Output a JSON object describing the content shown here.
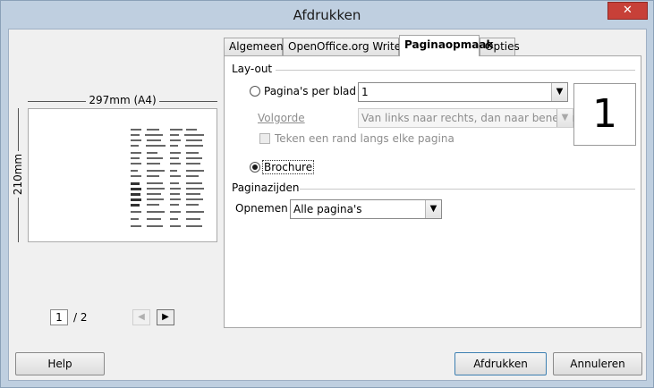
{
  "window": {
    "title": "Afdrukken",
    "close_glyph": "✕"
  },
  "preview": {
    "width_label": "297mm (A4)",
    "height_label": "210mm",
    "page_number": "1",
    "page_total": "/ 2",
    "prev_icon": "◀",
    "next_icon": "▶"
  },
  "tabs": [
    {
      "label": "Algemeen"
    },
    {
      "label": "OpenOffice.org Writer"
    },
    {
      "label": "Paginaopmaak"
    },
    {
      "label": "Opties"
    }
  ],
  "layout": {
    "section_title": "Lay-out",
    "pages_per_sheet_label": "Pagina's per blad",
    "pages_per_sheet_value": "1",
    "order_label": "Volgorde",
    "order_value": "Van links naar rechts, dan naar beneden",
    "border_label": "Teken een rand langs elke pagina",
    "brochure_label": "Brochure",
    "preview_number": "1"
  },
  "page_sides": {
    "section_title": "Paginazijden",
    "include_label": "Opnemen",
    "include_value": "Alle pagina's"
  },
  "buttons": {
    "help": "Help",
    "print": "Afdrukken",
    "cancel": "Annuleren"
  }
}
